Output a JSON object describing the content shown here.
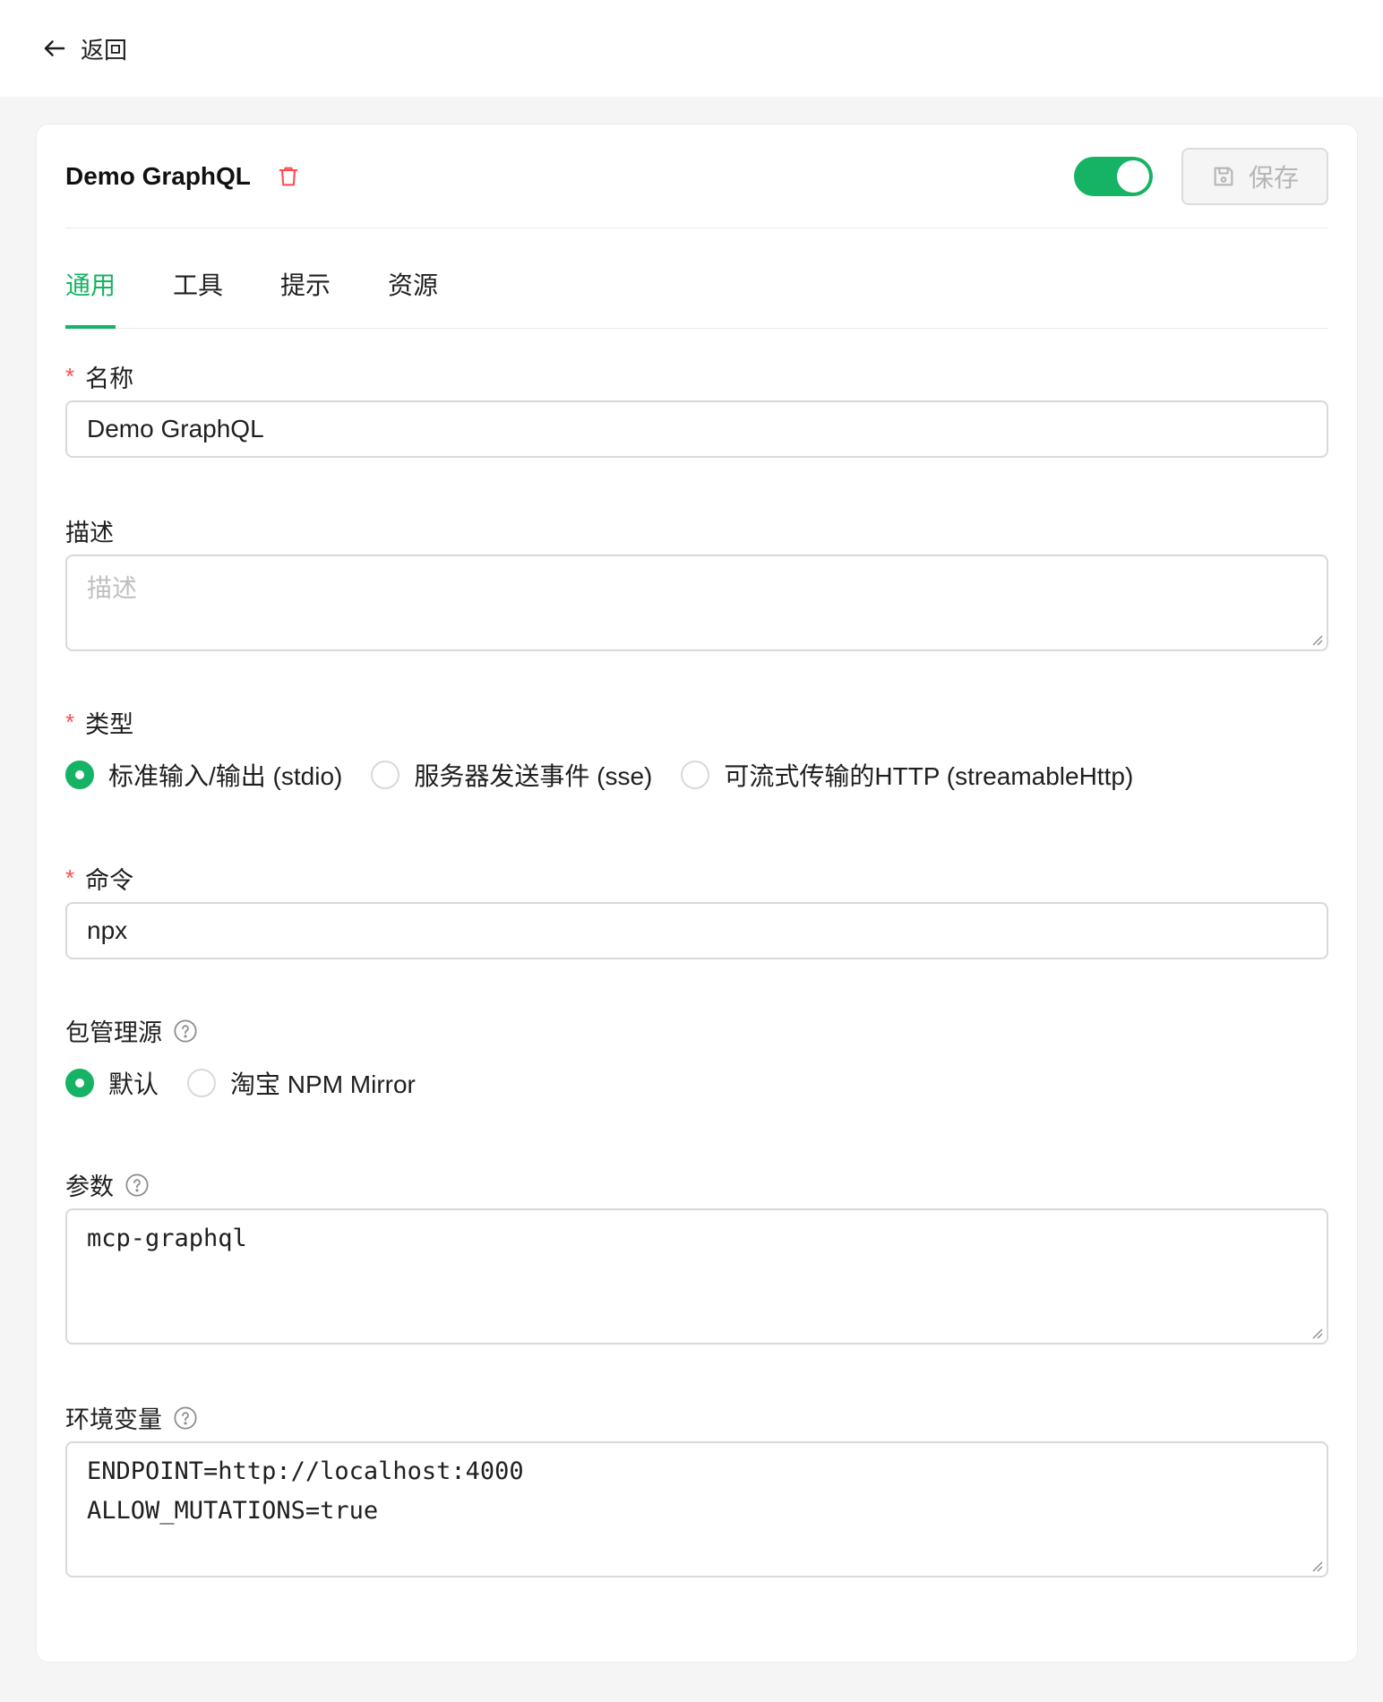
{
  "topbar": {
    "back_label": "返回"
  },
  "server": {
    "title": "Demo GraphQL",
    "enabled": true,
    "save_label": "保存"
  },
  "tabs": [
    {
      "label": "通用",
      "active": true
    },
    {
      "label": "工具",
      "active": false
    },
    {
      "label": "提示",
      "active": false
    },
    {
      "label": "资源",
      "active": false
    }
  ],
  "form": {
    "name": {
      "label": "名称",
      "required": true,
      "value": "Demo GraphQL"
    },
    "description": {
      "label": "描述",
      "required": false,
      "placeholder": "描述",
      "value": ""
    },
    "type": {
      "label": "类型",
      "required": true,
      "options": [
        {
          "label": "标准输入/输出 (stdio)",
          "checked": true
        },
        {
          "label": "服务器发送事件 (sse)",
          "checked": false
        },
        {
          "label": "可流式传输的HTTP (streamableHttp)",
          "checked": false
        }
      ]
    },
    "command": {
      "label": "命令",
      "required": true,
      "value": "npx"
    },
    "registry": {
      "label": "包管理源",
      "options": [
        {
          "label": "默认",
          "checked": true
        },
        {
          "label": "淘宝 NPM Mirror",
          "checked": false
        }
      ]
    },
    "args": {
      "label": "参数",
      "value": "mcp-graphql"
    },
    "env": {
      "label": "环境变量",
      "lines": [
        "ENDPOINT=http://localhost:4000",
        "ALLOW_MUTATIONS=true"
      ]
    }
  },
  "colors": {
    "accent": "#16b364",
    "danger": "#ff4d4f",
    "border": "#d9d9d9"
  },
  "icons": {
    "back": "arrow-left-icon",
    "delete": "trash-icon",
    "save": "floppy-disk-icon",
    "help": "question-circle-icon"
  }
}
